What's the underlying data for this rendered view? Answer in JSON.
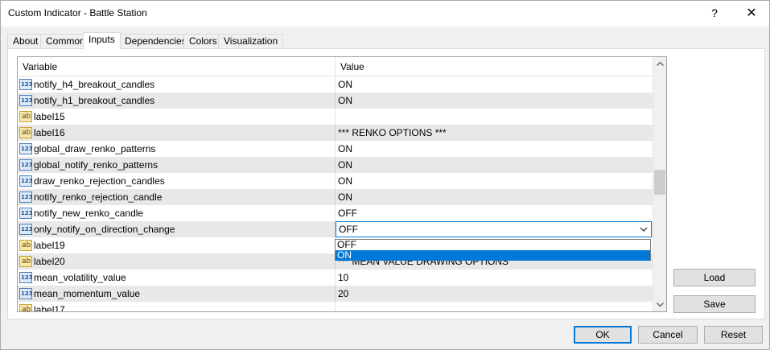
{
  "window": {
    "title": "Custom Indicator - Battle Station",
    "help_label": "?",
    "close_label": "✕"
  },
  "tabs": [
    "About",
    "Common",
    "Inputs",
    "Dependencies",
    "Colors",
    "Visualization"
  ],
  "active_tab": "Inputs",
  "grid": {
    "columns": [
      "Variable",
      "Value"
    ],
    "rows": [
      {
        "icon": "number-icon",
        "name": "notify_h4_breakout_candles",
        "value": "ON"
      },
      {
        "icon": "number-icon",
        "name": "notify_h1_breakout_candles",
        "value": "ON"
      },
      {
        "icon": "string-icon",
        "name": "label15",
        "value": ""
      },
      {
        "icon": "string-icon",
        "name": "label16",
        "value": "*** RENKO OPTIONS ***"
      },
      {
        "icon": "number-icon",
        "name": "global_draw_renko_patterns",
        "value": "ON"
      },
      {
        "icon": "number-icon",
        "name": "global_notify_renko_patterns",
        "value": "ON"
      },
      {
        "icon": "number-icon",
        "name": "draw_renko_rejection_candles",
        "value": "ON"
      },
      {
        "icon": "number-icon",
        "name": "notify_renko_rejection_candle",
        "value": "ON"
      },
      {
        "icon": "number-icon",
        "name": "notify_new_renko_candle",
        "value": "OFF"
      },
      {
        "icon": "number-icon",
        "name": "only_notify_on_direction_change",
        "value": "OFF"
      },
      {
        "icon": "string-icon",
        "name": "label19",
        "value": ""
      },
      {
        "icon": "string-icon",
        "name": "label20",
        "value": "*** MEAN VALUE DRAWING OPTIONS"
      },
      {
        "icon": "number-icon",
        "name": "mean_volatility_value",
        "value": "10"
      },
      {
        "icon": "number-icon",
        "name": "mean_momentum_value",
        "value": "20"
      },
      {
        "icon": "string-icon",
        "name": "label17",
        "value": ""
      }
    ],
    "editing_row": 9,
    "dropdown_options": [
      "OFF",
      "ON"
    ],
    "dropdown_highlighted": 1
  },
  "buttons": {
    "load": "Load",
    "save": "Save",
    "ok": "OK",
    "cancel": "Cancel",
    "reset": "Reset"
  },
  "colors": {
    "accent": "#0078d7",
    "alt_row": "#e8e8e8"
  }
}
